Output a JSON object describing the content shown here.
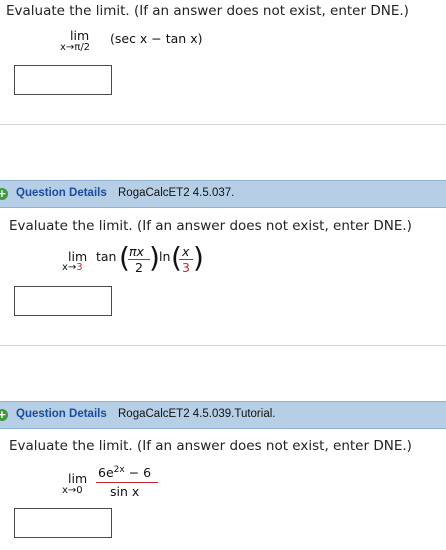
{
  "q1": {
    "prompt": "Evaluate the limit. (If an answer does not exist, enter DNE.)",
    "lim": "lim",
    "sub": "x→π/2",
    "expr": "(sec x − tan x)",
    "answer": ""
  },
  "q2": {
    "details_label": "Question Details",
    "id": "RogaCalcET2 4.5.037.",
    "prompt": "Evaluate the limit. (If an answer does not exist, enter DNE.)",
    "lim": "lim",
    "sub_var": "x→",
    "sub_val": "3",
    "tan": "tan",
    "num1": "πx",
    "den1": "2",
    "ln": "ln",
    "num2": "x",
    "den2": "3",
    "answer": ""
  },
  "q3": {
    "details_label": "Question Details",
    "id": "RogaCalcET2 4.5.039.Tutorial.",
    "prompt": "Evaluate the limit. (If an answer does not exist, enter DNE.)",
    "lim": "lim",
    "sub": "x→0",
    "num_base": "6e",
    "num_exp": "2x",
    "num_rest": " − 6",
    "den": "sin x",
    "answer": ""
  },
  "colors": {
    "bar": "#b6cfe6",
    "link": "#1a4c9c",
    "accent_red": "#c0282d",
    "plus_green": "#3f9a3a"
  }
}
